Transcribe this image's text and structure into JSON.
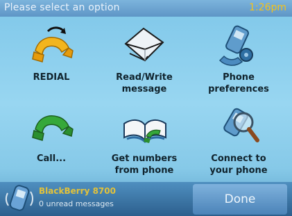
{
  "header": {
    "title": "Please select an option",
    "time": "1:26pm"
  },
  "menu": [
    {
      "label": "REDIAL",
      "icon": "redial-icon"
    },
    {
      "label": "Read/Write\nmessage",
      "icon": "envelope-icon"
    },
    {
      "label": "Phone\npreferences",
      "icon": "phone-settings-icon"
    },
    {
      "label": "Call...",
      "icon": "call-icon"
    },
    {
      "label": "Get numbers\nfrom phone",
      "icon": "phonebook-icon"
    },
    {
      "label": "Connect to\nyour phone",
      "icon": "phone-search-icon"
    }
  ],
  "footer": {
    "device": "BlackBerry 8700",
    "unread": "0 unread messages",
    "done": "Done"
  },
  "colors": {
    "clock": "#f5c21a",
    "device_name": "#e2c23a",
    "background": "#8fd0ef"
  }
}
